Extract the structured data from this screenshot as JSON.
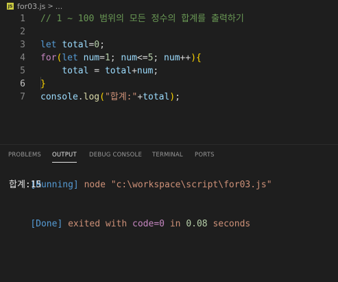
{
  "breadcrumb": {
    "icon_text": "JS",
    "file": "for03.js",
    "separator": ">",
    "more": "..."
  },
  "editor": {
    "line_numbers": [
      "1",
      "2",
      "3",
      "4",
      "5",
      "6",
      "7"
    ],
    "active_line": "6",
    "lines": [
      [
        {
          "t": "// 1 ~ 100 범위의 모든 정수의 합계를 출력하기",
          "c": "c-comment"
        }
      ],
      [],
      [
        {
          "t": "let",
          "c": "c-kw"
        },
        {
          "t": " ",
          "c": "c-op"
        },
        {
          "t": "total",
          "c": "c-var"
        },
        {
          "t": "=",
          "c": "c-op"
        },
        {
          "t": "0",
          "c": "c-num"
        },
        {
          "t": ";",
          "c": "c-op"
        }
      ],
      [
        {
          "t": "for",
          "c": "c-ctrl"
        },
        {
          "t": "(",
          "c": "c-br1"
        },
        {
          "t": "let",
          "c": "c-kw"
        },
        {
          "t": " ",
          "c": "c-op"
        },
        {
          "t": "num",
          "c": "c-var"
        },
        {
          "t": "=",
          "c": "c-op"
        },
        {
          "t": "1",
          "c": "c-num"
        },
        {
          "t": "; ",
          "c": "c-op"
        },
        {
          "t": "num",
          "c": "c-var"
        },
        {
          "t": "<=",
          "c": "c-op"
        },
        {
          "t": "5",
          "c": "c-num"
        },
        {
          "t": "; ",
          "c": "c-op"
        },
        {
          "t": "num",
          "c": "c-var"
        },
        {
          "t": "++",
          "c": "c-op"
        },
        {
          "t": ")",
          "c": "c-br1"
        },
        {
          "t": "{",
          "c": "c-br1"
        }
      ],
      [
        {
          "t": "    ",
          "c": "c-op"
        },
        {
          "t": "total",
          "c": "c-var"
        },
        {
          "t": " = ",
          "c": "c-op"
        },
        {
          "t": "total",
          "c": "c-var"
        },
        {
          "t": "+",
          "c": "c-op"
        },
        {
          "t": "num",
          "c": "c-var"
        },
        {
          "t": ";",
          "c": "c-op"
        }
      ],
      [
        {
          "t": "}",
          "c": "c-br1"
        }
      ],
      [
        {
          "t": "console",
          "c": "c-var"
        },
        {
          "t": ".",
          "c": "c-op"
        },
        {
          "t": "log",
          "c": "c-fn"
        },
        {
          "t": "(",
          "c": "c-br1"
        },
        {
          "t": "\"합계:\"",
          "c": "c-str"
        },
        {
          "t": "+",
          "c": "c-op"
        },
        {
          "t": "total",
          "c": "c-var"
        },
        {
          "t": ")",
          "c": "c-br1"
        },
        {
          "t": ";",
          "c": "c-op"
        }
      ]
    ]
  },
  "panel": {
    "tabs": [
      "PROBLEMS",
      "OUTPUT",
      "DEBUG CONSOLE",
      "TERMINAL",
      "PORTS"
    ],
    "active_tab": "OUTPUT"
  },
  "output": {
    "running_tag": "[Running]",
    "running_cmd": " node \"c:\\workspace\\script\\for03.js\"",
    "result": "합계:15",
    "done_tag": "[Done]",
    "done_text_1": " exited with ",
    "done_code_label": "code",
    "done_code_eq": "=",
    "done_code_value": "0",
    "done_text_2": " in ",
    "done_seconds": "0.08",
    "done_text_3": " seconds"
  },
  "colors": {
    "editor_bg": "#1e1e1e",
    "comment": "#6a9955",
    "keyword": "#569cd6",
    "control": "#c586c0",
    "variable": "#9cdcfe",
    "number": "#b5cea8",
    "string": "#ce9178",
    "bracket": "#ffd700"
  }
}
